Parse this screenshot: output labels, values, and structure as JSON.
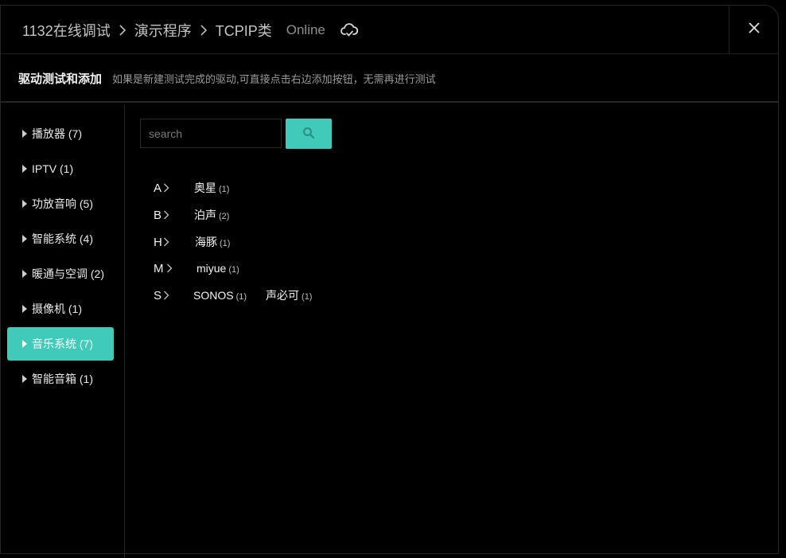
{
  "breadcrumb": [
    "1132在线调试",
    "演示程序",
    "TCPIP类"
  ],
  "status": "Online",
  "subheader": {
    "title": "驱动测试和添加",
    "hint": "如果是新建测试完成的驱动,可直接点击右边添加按钮，无需再进行测试"
  },
  "sidebar": [
    {
      "label": "播放器 (7)"
    },
    {
      "label": "IPTV (1)"
    },
    {
      "label": "功放音响 (5)"
    },
    {
      "label": "智能系统 (4)"
    },
    {
      "label": "暖通与空调 (2)"
    },
    {
      "label": "摄像机 (1)"
    },
    {
      "label": "音乐系统 (7)",
      "active": true
    },
    {
      "label": "智能音箱 (1)"
    }
  ],
  "search": {
    "placeholder": "search"
  },
  "groups": [
    {
      "letter": "A",
      "brands": [
        {
          "name": "奥星",
          "count": "(1)"
        }
      ]
    },
    {
      "letter": "B",
      "brands": [
        {
          "name": "泊声",
          "count": "(2)"
        }
      ]
    },
    {
      "letter": "H",
      "brands": [
        {
          "name": "海豚",
          "count": "(1)"
        }
      ]
    },
    {
      "letter": "M",
      "brands": [
        {
          "name": "miyue",
          "count": "(1)"
        }
      ]
    },
    {
      "letter": "S",
      "brands": [
        {
          "name": "SONOS",
          "count": "(1)"
        },
        {
          "name": "声必可",
          "count": "(1)"
        }
      ]
    }
  ],
  "colors": {
    "accent": "#3fcab9",
    "background": "#000000",
    "border": "#262626"
  }
}
